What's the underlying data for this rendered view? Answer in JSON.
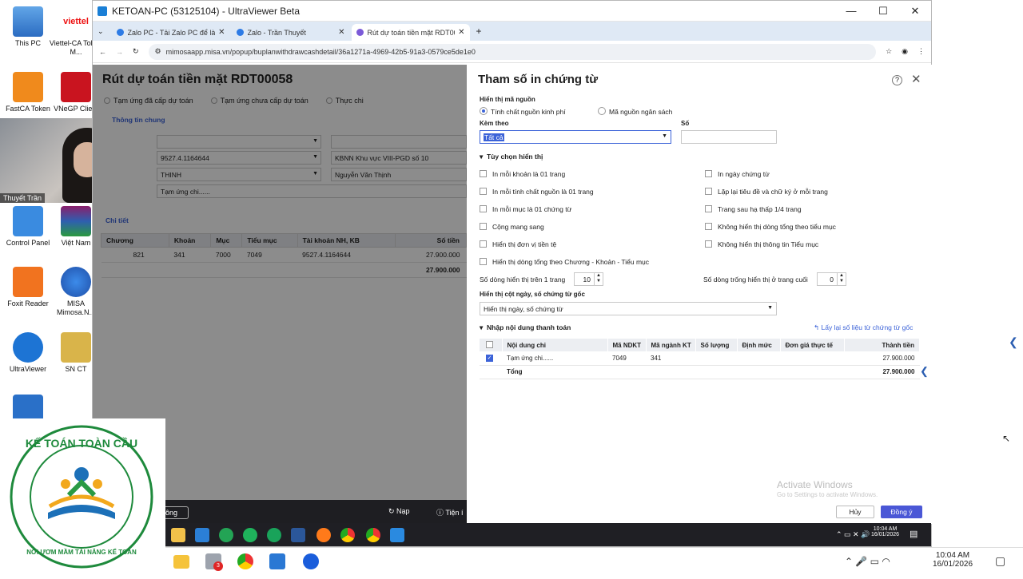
{
  "desktop": {
    "icons": [
      {
        "label": "This PC"
      },
      {
        "label": "Viettel-CA Token M..."
      },
      {
        "label": "FastCA Token"
      },
      {
        "label": "VNeGP Client"
      },
      {
        "label": "Control Panel"
      },
      {
        "label": "Việt Nam"
      },
      {
        "label": "Foxit Reader"
      },
      {
        "label": "MISA Mimosa.N..."
      },
      {
        "label": "UltraViewer"
      },
      {
        "label": "SN CT"
      }
    ],
    "webcam_name": "Thuyết Trần",
    "logo_top": "KẾ TOÁN TOÀN CẦU",
    "logo_bottom": "NƠI ƯƠM MẦM TÀI NĂNG KẾ TOÁN"
  },
  "window": {
    "title": "KETOAN-PC (53125104) - UltraViewer Beta",
    "controls": [
      "—",
      "☐",
      "✕"
    ]
  },
  "browser": {
    "tabs": [
      {
        "label": "Zalo PC - Tải Zalo PC để làm việc"
      },
      {
        "label": "Zalo - Trần Thuyết"
      },
      {
        "label": "Rút dự toán tiền mặt RDT0005..."
      }
    ],
    "url": "mimosaapp.misa.vn/popup/buplanwithdrawcashdetail/36a1271a-4969-42b5-91a3-0579ce5de1e0"
  },
  "misa": {
    "title": "Rút dự toán tiền mặt RDT00058",
    "options": [
      "Tạm ứng đã cấp dự toán",
      "Tạm ứng chưa cấp dự toán",
      "Thực chi"
    ],
    "tab_general": "Thông tin chung",
    "fields": [
      "9527.4.1164644",
      "KBNN Khu vực VIII-PGD số 10",
      "THINH",
      "Nguyễn Văn Thịnh",
      "Tạm ứng chi......"
    ],
    "detail_tab": "Chi tiết",
    "table": {
      "headers": [
        "Chương",
        "Khoản",
        "Mục",
        "Tiểu mục",
        "Tài khoản NH, KB",
        "Số tiền"
      ],
      "row": [
        "821",
        "341",
        "7000",
        "7049",
        "9527.4.1164644",
        "27.900.000"
      ],
      "total": "27.900.000"
    },
    "footer": {
      "left": "ông",
      "reload": "Nạp",
      "util": "Tiện í"
    }
  },
  "dialog": {
    "title": "Tham số in chứng từ",
    "source_label": "Hiển thị mã nguồn",
    "source_opt1": "Tính chất nguồn kinh phí",
    "source_opt2": "Mã nguồn ngân sách",
    "attach_label": "Kèm theo",
    "attach_value": "Tất cả",
    "number_label": "Số",
    "display_options_label": "Tùy chọn hiển thị",
    "left_options": [
      "In mỗi khoản là 01 trang",
      "In mỗi tính chất nguồn là 01 trang",
      "In mỗi mục là 01 chứng từ",
      "Cộng mang sang",
      "Hiển thị đơn vị tiền tệ",
      "Hiển thị dòng tổng theo Chương - Khoản - Tiểu mục"
    ],
    "right_options": [
      "In ngày chứng từ",
      "Lặp lại tiêu đề và chữ ký ở mỗi trang",
      "Trang sau hạ thấp 1/4 trang",
      "Không hiển thị dòng tổng theo tiểu mục",
      "Không hiển thị thông tin Tiểu mục"
    ],
    "rows_per_page_label": "Số dòng hiển thị trên 1 trang",
    "rows_per_page": "10",
    "blank_rows_label": "Số dòng trống hiển thị ở trang cuối",
    "blank_rows": "0",
    "date_col_label": "Hiển thị cột ngày, số chứng từ gốc",
    "date_col_value": "Hiển thị ngày, số chứng từ",
    "payment_label": "Nhập nội dung thanh toán",
    "reload_link": "Lấy lại số liệu từ chứng từ gốc",
    "table": {
      "headers": [
        "Nội dung chi",
        "Mã NDKT",
        "Mã ngành KT",
        "Số lượng",
        "Định mức",
        "Đơn giá thực tế",
        "Thành tiền"
      ],
      "row": [
        "Tạm ứng chi......",
        "7049",
        "341",
        "",
        "",
        "",
        "27.900.000"
      ],
      "total_label": "Tổng",
      "total": "27.900.000"
    },
    "cancel": "Hủy",
    "ok": "Đồng ý"
  },
  "watermark": {
    "line1": "Activate Windows",
    "line2": "Go to Settings to activate Windows."
  },
  "remote_taskbar": {
    "time": "10:04 AM",
    "date": "16/01/2026"
  },
  "local_taskbar": {
    "time": "10:04 AM",
    "date": "16/01/2026",
    "badge": "3"
  },
  "colors": {
    "accent": "#3c63d8",
    "primary_button": "#4a57d6"
  }
}
